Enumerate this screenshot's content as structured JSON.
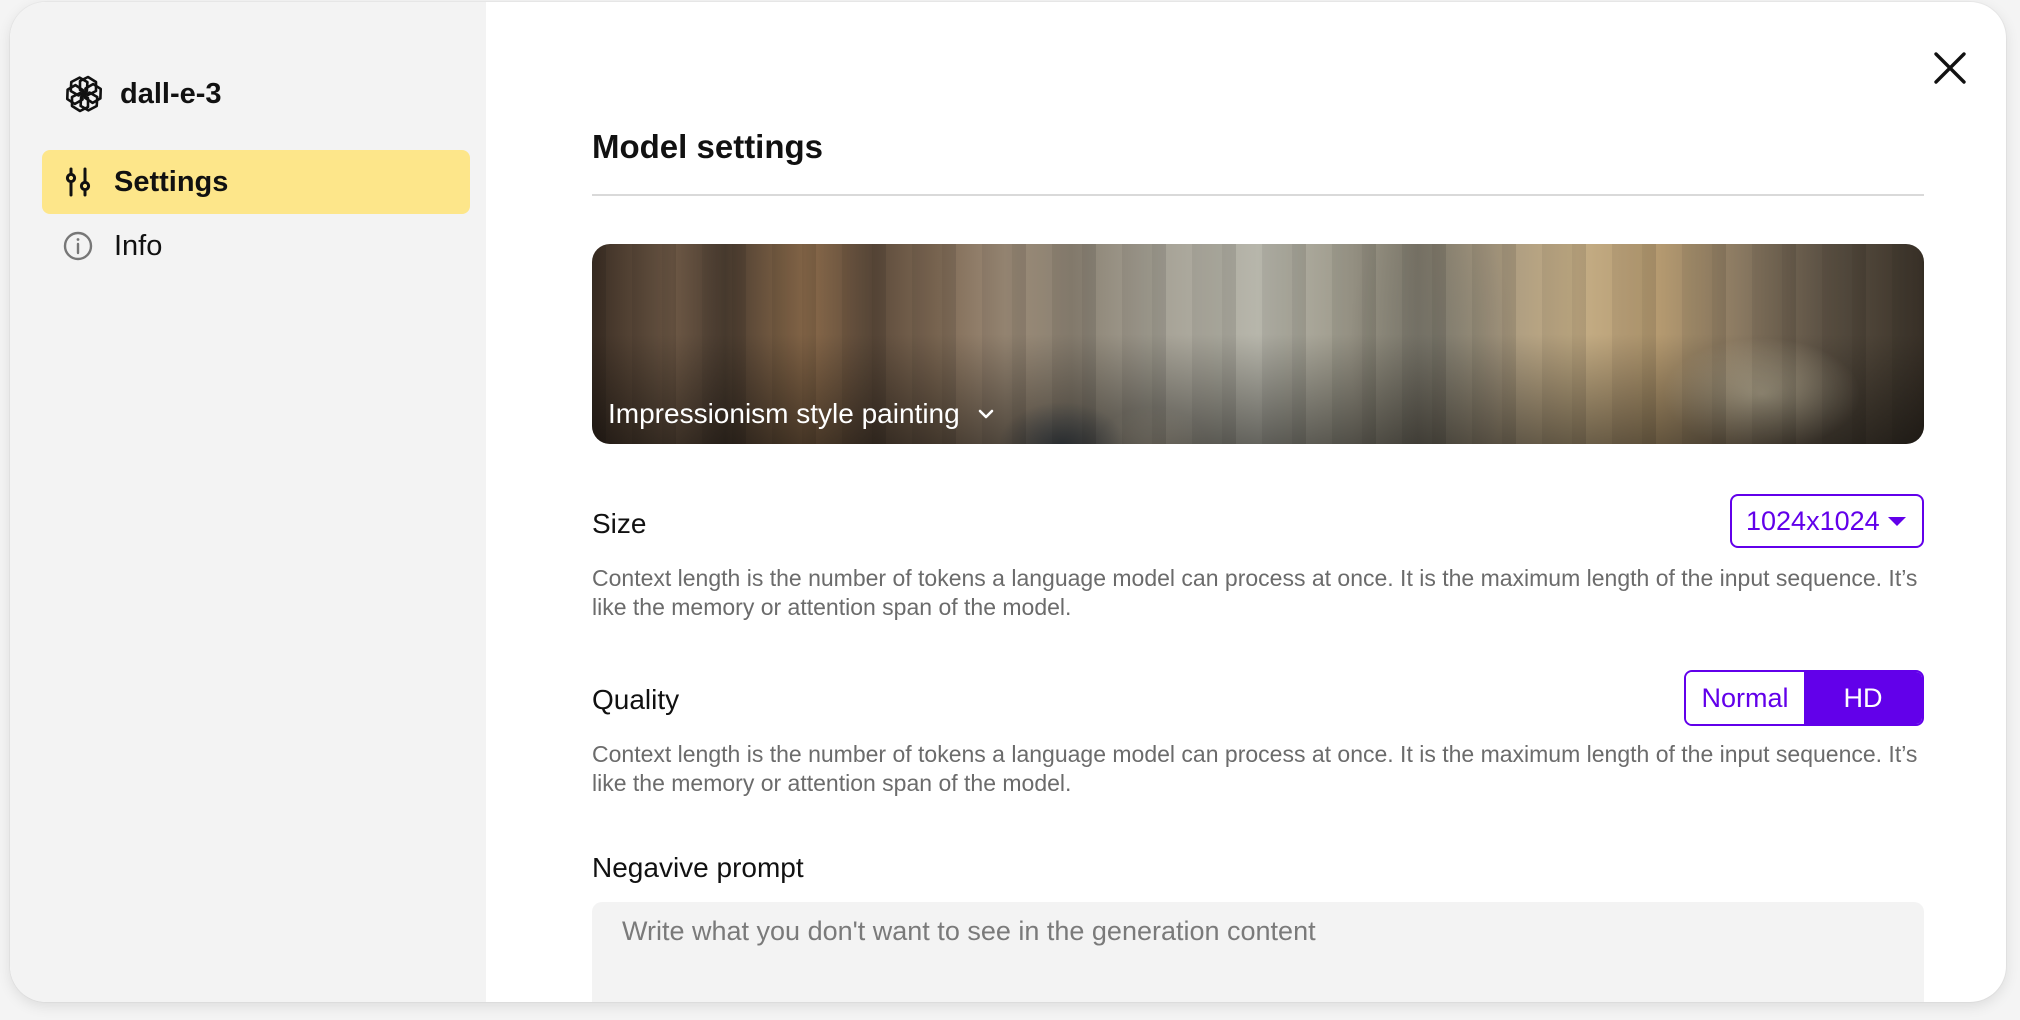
{
  "sidebar": {
    "model_name": "dall-e-3",
    "model_icon": "openai-logo-icon",
    "items": [
      {
        "label": "Settings",
        "icon": "sliders-icon",
        "active": true
      },
      {
        "label": "Info",
        "icon": "info-circle-icon",
        "active": false
      }
    ]
  },
  "main": {
    "title": "Model settings",
    "close_icon": "close-icon",
    "style": {
      "label": "Impressionism style painting",
      "icon": "chevron-down-icon"
    },
    "size": {
      "label": "Size",
      "value": "1024x1024",
      "description": "Context length is the number of tokens a language model can process at once. It is the maximum length of the input sequence. It’s like the memory or attention span of the model."
    },
    "quality": {
      "label": "Quality",
      "options": [
        "Normal",
        "HD"
      ],
      "selected": "HD",
      "description": "Context length is the number of tokens a language model can process at once. It is the maximum length of the input sequence. It’s like the memory or attention span of the model."
    },
    "negative_prompt": {
      "label": "Negavive prompt",
      "placeholder": "Write what you don't want to see in the generation content",
      "value": ""
    }
  },
  "colors": {
    "accent": "#6200ea",
    "active_nav_bg": "#fde68a",
    "sidebar_bg": "#f3f3f3",
    "description_text": "#6b6b6b"
  }
}
